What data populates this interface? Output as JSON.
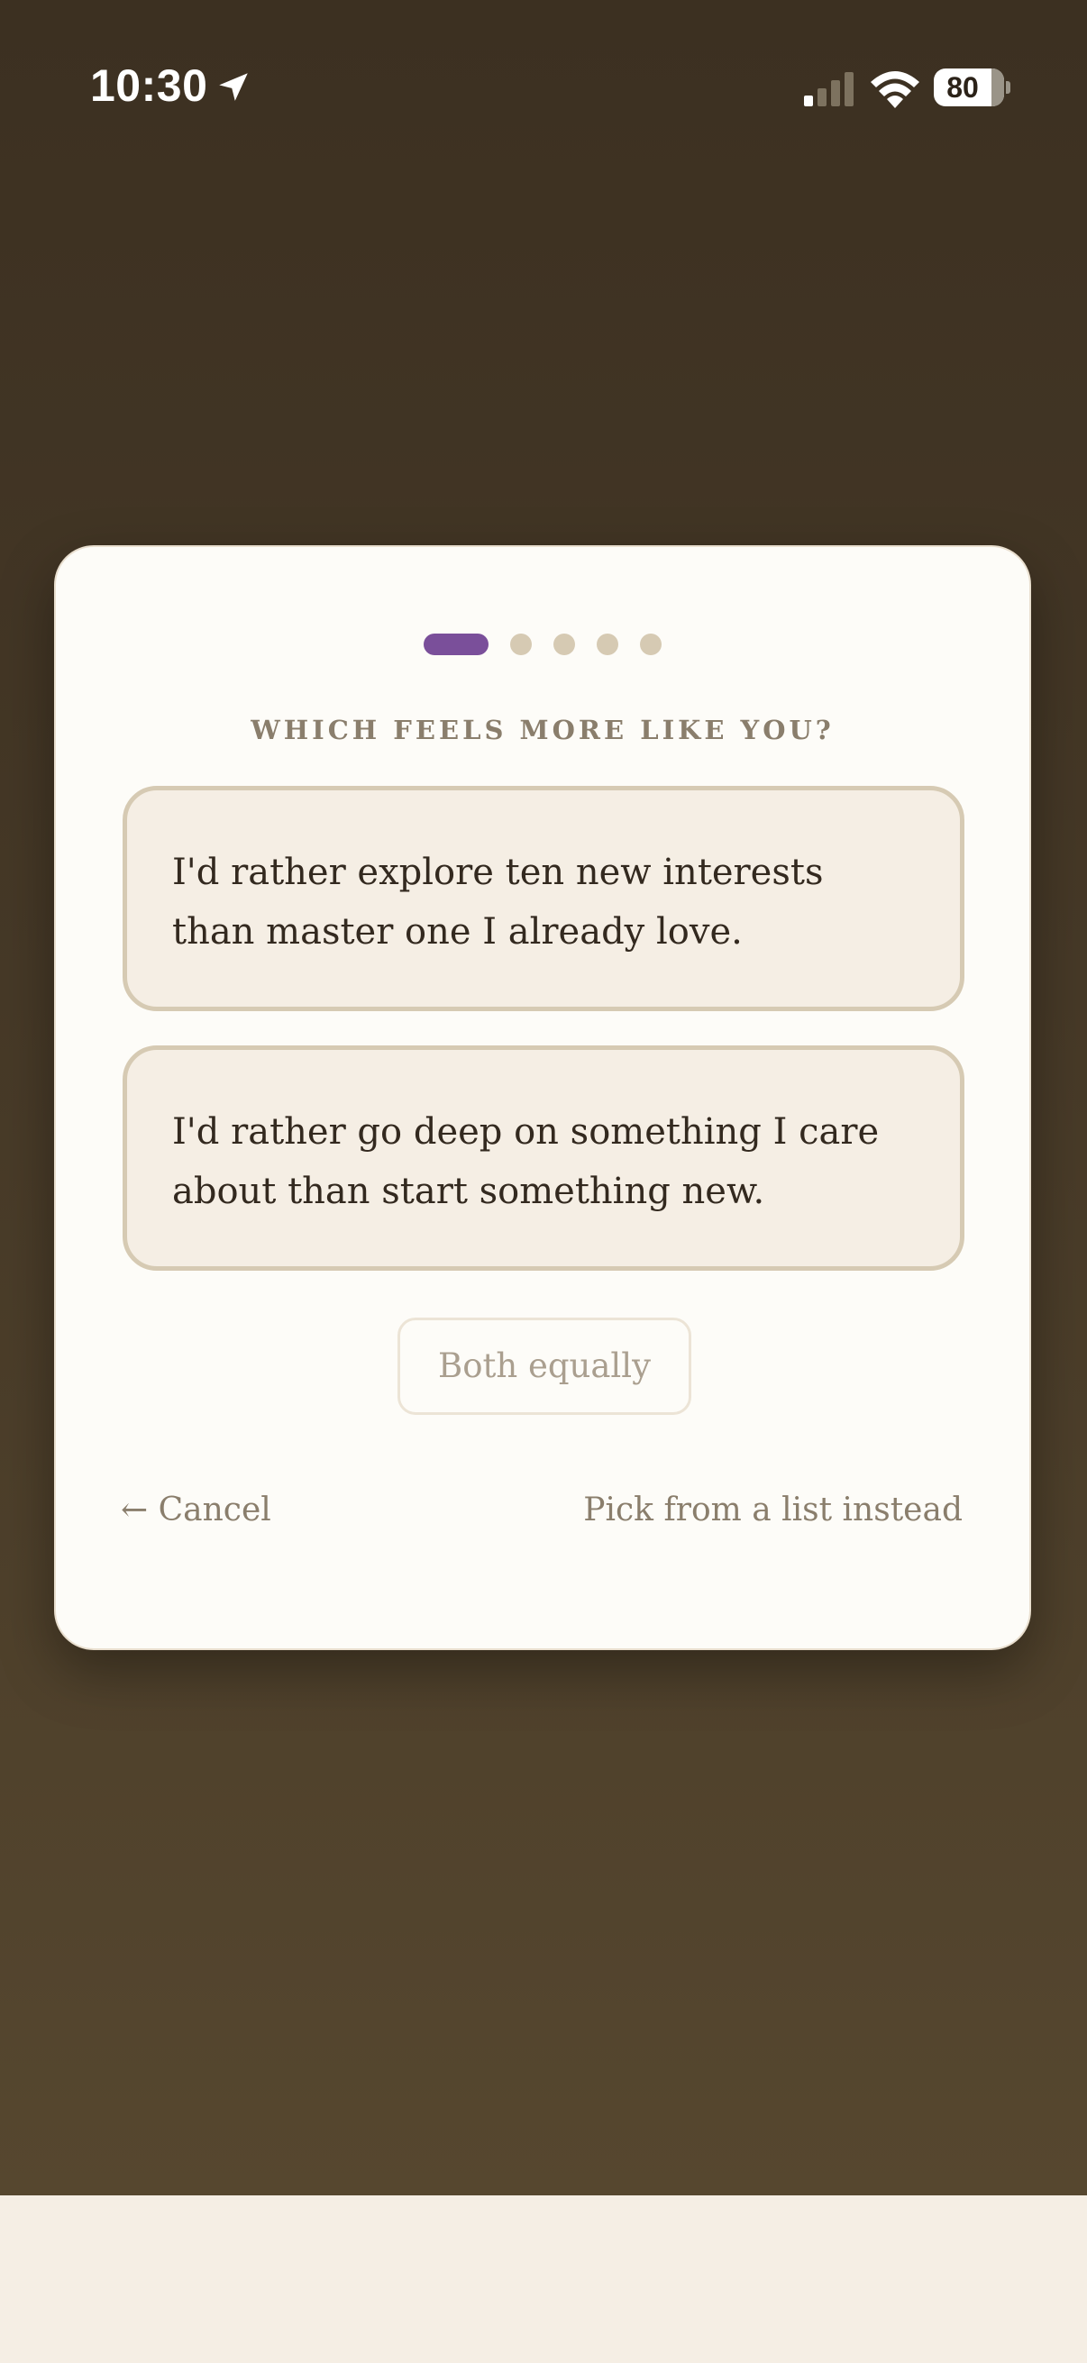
{
  "status_bar": {
    "time": "10:30",
    "battery_level": "80",
    "icons": [
      "location-arrow-icon",
      "cellular-signal-icon",
      "wifi-icon",
      "battery-icon"
    ]
  },
  "quiz": {
    "progress": {
      "total_steps": 5,
      "current_step": 1
    },
    "prompt": "WHICH FEELS MORE LIKE YOU?",
    "options": [
      {
        "text": "I'd rather explore ten new interests than master one I already love."
      },
      {
        "text": "I'd rather go deep on something I care about than start something new."
      }
    ],
    "both_label": "Both equally",
    "cancel_label": "← Cancel",
    "list_label": "Pick from a list instead"
  },
  "colors": {
    "accent": "#7a4f9a",
    "backdrop_top": "#3c3021",
    "backdrop_bottom": "#56472f",
    "card": "#fdfcf8",
    "option_fill": "#f5eee4",
    "option_border": "#d6cab3"
  }
}
